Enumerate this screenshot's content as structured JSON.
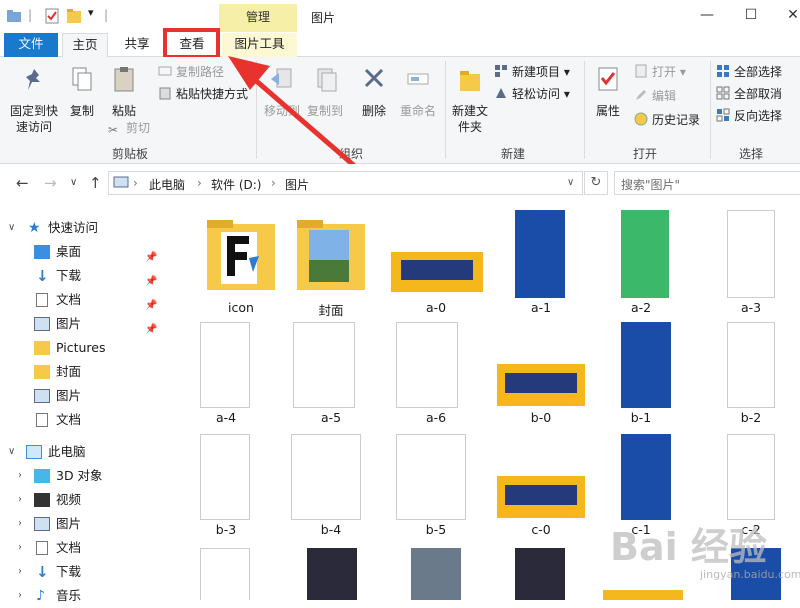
{
  "titlebar": {
    "manage_tab": "管理",
    "title": "图片",
    "minimize": "—",
    "maximize": "☐",
    "close": "✕"
  },
  "tabs": {
    "file": "文件",
    "home": "主页",
    "share": "共享",
    "view": "查看",
    "picture_tools": "图片工具"
  },
  "ribbon": {
    "pin_quick": "固定到快速访问",
    "copy": "复制",
    "paste": "粘贴",
    "copy_path": "复制路径",
    "paste_shortcut": "粘贴快捷方式",
    "cut": "剪切",
    "clipboard_group": "剪贴板",
    "move_to": "移动到",
    "copy_to": "复制到",
    "delete": "删除",
    "rename": "重命名",
    "organize_group": "组织",
    "new_folder": "新建文件夹",
    "new_item": "新建项目",
    "easy_access": "轻松访问",
    "new_group": "新建",
    "properties": "属性",
    "open": "打开",
    "edit": "编辑",
    "history": "历史记录",
    "open_group": "打开",
    "select_all": "全部选择",
    "select_none": "全部取消",
    "invert_selection": "反向选择",
    "select_group": "选择"
  },
  "address": {
    "crumb1": "此电脑",
    "crumb2": "软件 (D:)",
    "crumb3": "图片",
    "search_placeholder": "搜索\"图片\""
  },
  "nav": {
    "quick_access": "快速访问",
    "desktop": "桌面",
    "downloads": "下载",
    "documents": "文档",
    "pictures": "图片",
    "pictures_en": "Pictures",
    "cover": "封面",
    "pictures2": "图片",
    "documents2": "文档",
    "this_pc": "此电脑",
    "objects3d": "3D 对象",
    "videos": "视频",
    "pc_pictures": "图片",
    "pc_documents": "文档",
    "pc_downloads": "下载",
    "music": "音乐"
  },
  "files": [
    "icon",
    "封面",
    "a-0",
    "a-1",
    "a-2",
    "a-3",
    "a-4",
    "a-5",
    "a-6",
    "b-0",
    "b-1",
    "b-2",
    "b-3",
    "b-4",
    "b-5",
    "c-0",
    "c-1",
    "c-2"
  ],
  "watermark": {
    "logo": "Bai 经验",
    "url": "jingyan.baidu.com"
  },
  "colors": {
    "file_tab": "#1979ca",
    "manage_tab": "#f6efa7",
    "highlight": "#e8322e",
    "folder": "#f7c948"
  }
}
